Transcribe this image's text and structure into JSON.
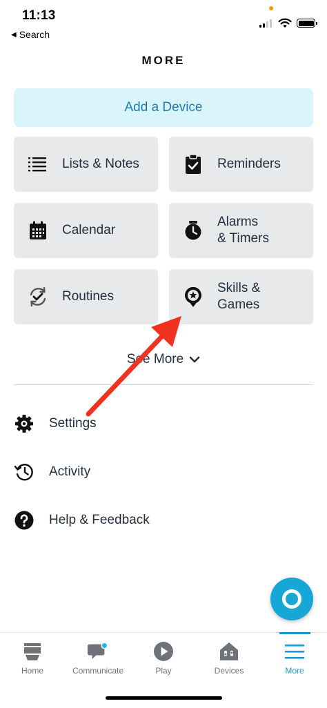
{
  "status_bar": {
    "time": "11:13",
    "back_label": "Search"
  },
  "page": {
    "title": "MORE"
  },
  "add_device": {
    "label": "Add a Device"
  },
  "tiles": [
    {
      "label": "Lists & Notes",
      "icon": "list-icon"
    },
    {
      "label": "Reminders",
      "icon": "clipboard-check-icon"
    },
    {
      "label": "Calendar",
      "icon": "calendar-icon"
    },
    {
      "label_line1": "Alarms",
      "label_line2": "& Timers",
      "icon": "alarm-clock-icon"
    },
    {
      "label": "Routines",
      "icon": "routines-icon"
    },
    {
      "label_line1": "Skills &",
      "label_line2": "Games",
      "icon": "skills-pin-icon"
    }
  ],
  "see_more": {
    "label": "See More"
  },
  "menu": [
    {
      "label": "Settings",
      "icon": "gear-icon"
    },
    {
      "label": "Activity",
      "icon": "history-icon"
    },
    {
      "label": "Help & Feedback",
      "icon": "help-icon"
    }
  ],
  "bottom_nav": [
    {
      "label": "Home",
      "icon": "home-icon"
    },
    {
      "label": "Communicate",
      "icon": "chat-icon"
    },
    {
      "label": "Play",
      "icon": "play-icon"
    },
    {
      "label": "Devices",
      "icon": "devices-icon"
    },
    {
      "label": "More",
      "icon": "menu-icon",
      "active": true
    }
  ],
  "colors": {
    "accent": "#1a98d5",
    "add_device_bg": "#d9f4fb",
    "tile_bg": "#e8e9eb",
    "annotation_arrow": "#f0321e",
    "alexa_button": "#17a7d6"
  }
}
